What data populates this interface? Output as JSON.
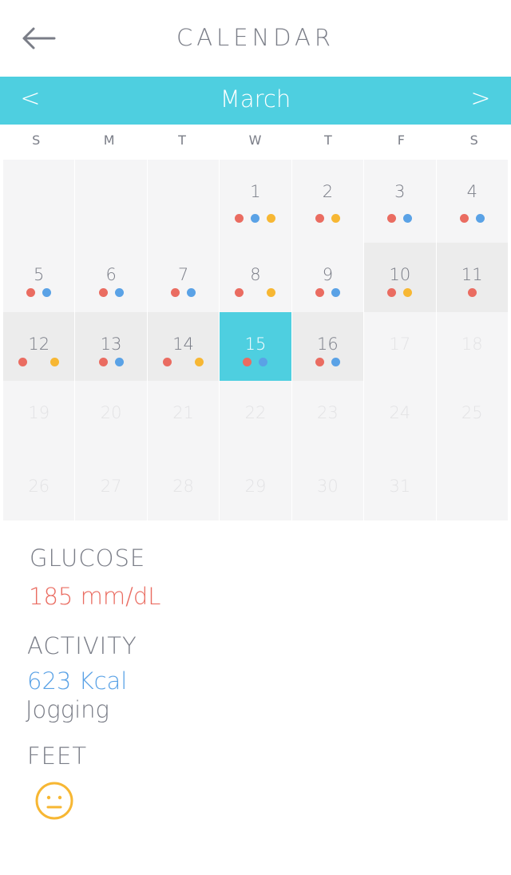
{
  "header": {
    "title": "CALENDAR",
    "back_icon": "arrow-left-icon"
  },
  "month_bar": {
    "month": "March",
    "prev_label": "<",
    "next_label": ">",
    "color": "#4ecfe0"
  },
  "weekdays": [
    "S",
    "M",
    "T",
    "W",
    "T",
    "F",
    "S"
  ],
  "calendar": {
    "rows": [
      [
        {
          "day": "",
          "dots": []
        },
        {
          "day": "",
          "dots": []
        },
        {
          "day": "",
          "dots": []
        },
        {
          "day": "1",
          "dots": [
            "red",
            "blue",
            "yellow"
          ]
        },
        {
          "day": "2",
          "dots": [
            "red",
            "yellow"
          ]
        },
        {
          "day": "3",
          "dots": [
            "red",
            "blue"
          ]
        },
        {
          "day": "4",
          "dots": [
            "red",
            "blue"
          ]
        }
      ],
      [
        {
          "day": "5",
          "dots": [
            "red",
            "blue"
          ]
        },
        {
          "day": "6",
          "dots": [
            "red",
            "blue"
          ]
        },
        {
          "day": "7",
          "dots": [
            "red",
            "blue"
          ]
        },
        {
          "day": "8",
          "dots": [
            "red",
            "gap",
            "yellow"
          ]
        },
        {
          "day": "9",
          "dots": [
            "red",
            "blue"
          ]
        },
        {
          "day": "10",
          "dots": [
            "red",
            "yellow"
          ],
          "shaded": true
        },
        {
          "day": "11",
          "dots": [
            "red"
          ],
          "shaded": true
        }
      ],
      [
        {
          "day": "12",
          "dots": [
            "red",
            "gap",
            "yellow"
          ],
          "shaded": true
        },
        {
          "day": "13",
          "dots": [
            "red",
            "blue"
          ],
          "shaded": true
        },
        {
          "day": "14",
          "dots": [
            "red",
            "gap",
            "yellow"
          ],
          "shaded": true
        },
        {
          "day": "15",
          "dots": [
            "red",
            "blue"
          ],
          "selected": true
        },
        {
          "day": "16",
          "dots": [
            "red",
            "blue"
          ],
          "shaded": true
        },
        {
          "day": "17",
          "dots": [],
          "faded": true
        },
        {
          "day": "18",
          "dots": [],
          "faded": true
        }
      ],
      [
        {
          "day": "19",
          "dots": [],
          "faded": true
        },
        {
          "day": "20",
          "dots": [],
          "faded": true
        },
        {
          "day": "21",
          "dots": [],
          "faded": true
        },
        {
          "day": "22",
          "dots": [],
          "faded": true
        },
        {
          "day": "23",
          "dots": [],
          "faded": true
        },
        {
          "day": "24",
          "dots": [],
          "faded": true
        },
        {
          "day": "25",
          "dots": [],
          "faded": true
        }
      ],
      [
        {
          "day": "26",
          "dots": [],
          "faded": true
        },
        {
          "day": "27",
          "dots": [],
          "faded": true
        },
        {
          "day": "28",
          "dots": [],
          "faded": true
        },
        {
          "day": "29",
          "dots": [],
          "faded": true
        },
        {
          "day": "30",
          "dots": [],
          "faded": true
        },
        {
          "day": "31",
          "dots": [],
          "faded": true
        },
        {
          "day": "",
          "dots": []
        }
      ]
    ],
    "dot_colors": {
      "red": "#ea6c61",
      "blue": "#5aa2e6",
      "yellow": "#f7b733"
    }
  },
  "details": {
    "glucose_label": "GLUCOSE",
    "glucose_value": "185 mm/dL",
    "activity_label": "ACTIVITY",
    "activity_value": "623 Kcal",
    "activity_type": "Jogging",
    "feet_label": "FEET",
    "feet_icon": "neutral-face-icon"
  }
}
